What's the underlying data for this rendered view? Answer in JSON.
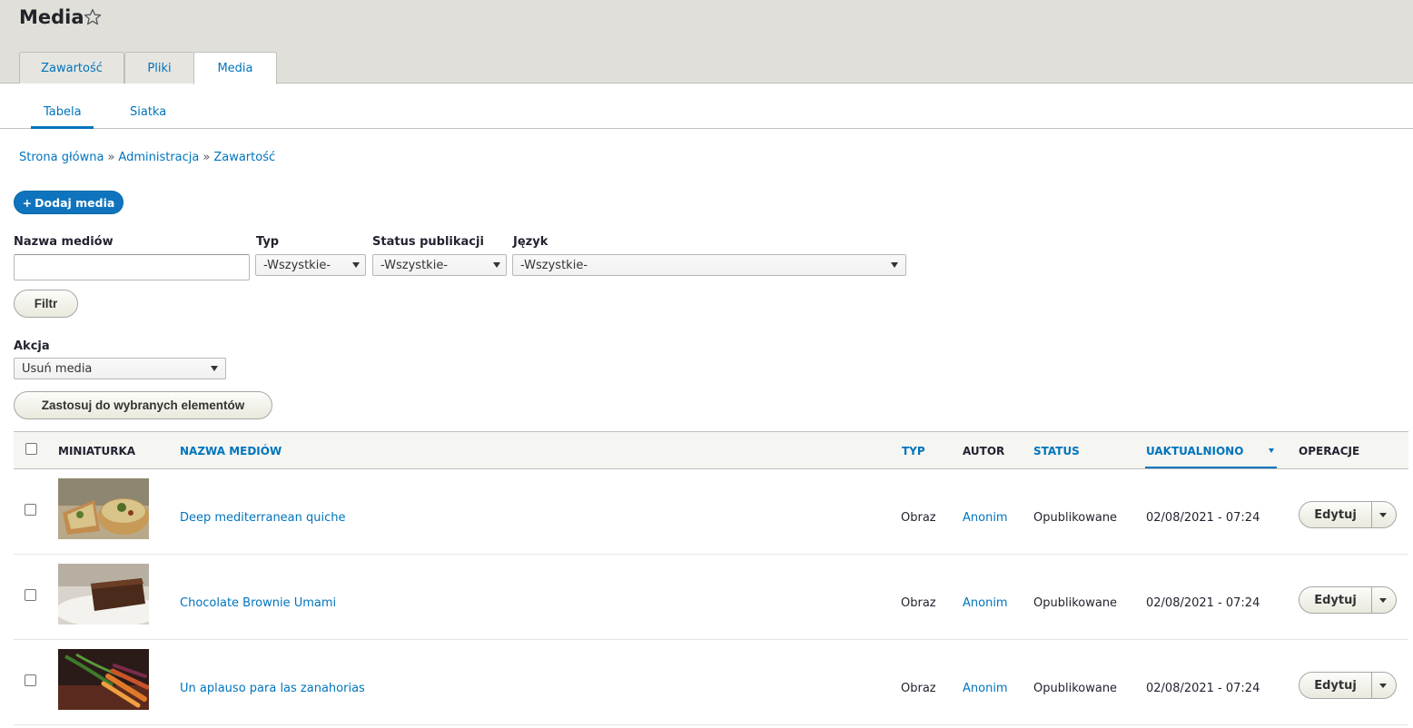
{
  "page": {
    "title": "Media"
  },
  "tabs": [
    {
      "label": "Zawartość"
    },
    {
      "label": "Pliki"
    },
    {
      "label": "Media",
      "active": true
    }
  ],
  "subtabs": [
    {
      "label": "Tabela",
      "active": true
    },
    {
      "label": "Siatka"
    }
  ],
  "breadcrumb": {
    "items": [
      "Strona główna",
      "Administracja",
      "Zawartość"
    ],
    "separator": "»"
  },
  "add_button": {
    "icon": "+",
    "label": "Dodaj media"
  },
  "filters": {
    "name": {
      "label": "Nazwa mediów",
      "value": ""
    },
    "type": {
      "label": "Typ",
      "value": "-Wszystkie-"
    },
    "status": {
      "label": "Status publikacji",
      "value": "-Wszystkie-"
    },
    "language": {
      "label": "Język",
      "value": "-Wszystkie-"
    },
    "submit_label": "Filtr"
  },
  "bulk": {
    "label": "Akcja",
    "value": "Usuń media",
    "apply_label": "Zastosuj do wybranych elementów"
  },
  "table": {
    "headers": {
      "thumbnail": "MINIATURKA",
      "name": "NAZWA MEDIÓW",
      "type": "TYP",
      "author": "AUTOR",
      "status": "STATUS",
      "updated": "UAKTUALNIONO",
      "operations": "OPERACJE"
    },
    "rows": [
      {
        "name": "Deep mediterranean quiche",
        "type": "Obraz",
        "author": "Anonim",
        "status": "Opublikowane",
        "updated": "02/08/2021 - 07:24",
        "operation": "Edytuj"
      },
      {
        "name": "Chocolate Brownie Umami",
        "type": "Obraz",
        "author": "Anonim",
        "status": "Opublikowane",
        "updated": "02/08/2021 - 07:24",
        "operation": "Edytuj"
      },
      {
        "name": "Un aplauso para las zanahorias",
        "type": "Obraz",
        "author": "Anonim",
        "status": "Opublikowane",
        "updated": "02/08/2021 - 07:24",
        "operation": "Edytuj"
      }
    ]
  },
  "colors": {
    "accent": "#0074bd",
    "header_bg": "#e0dfd9"
  }
}
